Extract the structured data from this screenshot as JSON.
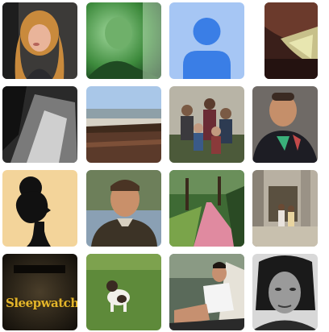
{
  "grid": {
    "tiles": [
      {
        "name": "avatar-woman-blonde",
        "kind": "photo"
      },
      {
        "name": "avatar-man-green-filter",
        "kind": "photo"
      },
      {
        "name": "avatar-default-placeholder",
        "kind": "placeholder",
        "icon": "person-silhouette-icon",
        "colors": {
          "bg": "#a6c6f4",
          "figure": "#3a7ee6"
        }
      },
      {
        "name": "avatar-closeup-selfie",
        "kind": "photo"
      },
      {
        "name": "avatar-abstract-bw",
        "kind": "photo"
      },
      {
        "name": "avatar-seaside-landscape",
        "kind": "photo"
      },
      {
        "name": "avatar-family-group",
        "kind": "photo"
      },
      {
        "name": "avatar-man-dark-shirt",
        "kind": "photo"
      },
      {
        "name": "avatar-woman-silhouette-drawing",
        "kind": "illustration"
      },
      {
        "name": "avatar-man-outdoor",
        "kind": "photo"
      },
      {
        "name": "avatar-garden-path",
        "kind": "photo"
      },
      {
        "name": "avatar-girls-courtyard",
        "kind": "photo"
      },
      {
        "name": "avatar-sleepwatcher-cover",
        "kind": "album-cover",
        "cover_title": "Sleepwatcher",
        "cover_small_text": "",
        "cover_bottom_text": ""
      },
      {
        "name": "avatar-dog-on-grass",
        "kind": "photo"
      },
      {
        "name": "avatar-man-reclining",
        "kind": "photo"
      },
      {
        "name": "avatar-woman-bw-portrait",
        "kind": "photo"
      }
    ]
  }
}
